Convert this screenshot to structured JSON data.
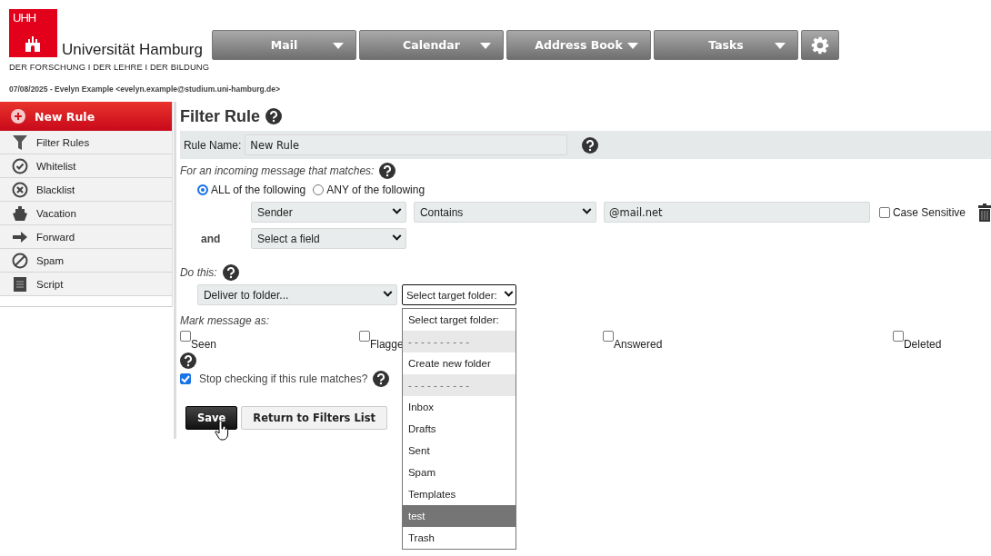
{
  "logo": {
    "mark": "UHH",
    "name": "Universität Hamburg",
    "tagline": "DER FORSCHUNG I DER LEHRE I DER BILDUNG"
  },
  "nav": [
    {
      "label": "Mail"
    },
    {
      "label": "Calendar"
    },
    {
      "label": "Address Book"
    },
    {
      "label": "Tasks"
    }
  ],
  "user_line": "07/08/2025 - Evelyn Example <evelyn.example@studium.uni-hamburg.de>",
  "sidebar": {
    "new_rule": "New Rule",
    "items": [
      {
        "label": "Filter Rules",
        "kind": "filter"
      },
      {
        "label": "Whitelist",
        "kind": "check"
      },
      {
        "label": "Blacklist",
        "kind": "cross"
      },
      {
        "label": "Vacation",
        "kind": "ship"
      },
      {
        "label": "Forward",
        "kind": "arrow"
      },
      {
        "label": "Spam",
        "kind": "ban"
      },
      {
        "label": "Script",
        "kind": "script"
      }
    ]
  },
  "form": {
    "title": "Filter Rule",
    "rule_name_label": "Rule Name:",
    "rule_name": "New Rule",
    "match_label": "For an incoming message that matches:",
    "match_modes": [
      {
        "label": "ALL of the following",
        "selected": true
      },
      {
        "label": "ANY of the following",
        "selected": false
      }
    ],
    "conditions": [
      {
        "field": "Sender",
        "operator": "Contains",
        "value": "@mail.net",
        "case_sensitive": {
          "label": "Case Sensitive",
          "checked": false
        }
      },
      {
        "prefix": "and",
        "field": "Select a field"
      }
    ],
    "action_label": "Do this:",
    "action": "Deliver to folder...",
    "target": "Select target folder:",
    "folder_options": [
      {
        "label": "Select target folder:",
        "kind": "option",
        "selected": false
      },
      {
        "label": "- - - - - - - - - -",
        "kind": "separator",
        "selected": false
      },
      {
        "label": "Create new folder",
        "kind": "option",
        "selected": false
      },
      {
        "label": "- - - - - - - - - -",
        "kind": "separator",
        "selected": false
      },
      {
        "label": "Inbox",
        "kind": "option",
        "selected": false
      },
      {
        "label": "Drafts",
        "kind": "option",
        "selected": false
      },
      {
        "label": "Sent",
        "kind": "option",
        "selected": false
      },
      {
        "label": "Spam",
        "kind": "option",
        "selected": false
      },
      {
        "label": "Templates",
        "kind": "option",
        "selected": false
      },
      {
        "label": "test",
        "kind": "option",
        "selected": true
      },
      {
        "label": "Trash",
        "kind": "option",
        "selected": false
      }
    ],
    "mark_label": "Mark message as:",
    "flags": [
      {
        "label": "Seen",
        "checked": false
      },
      {
        "label": "Flagge",
        "checked": false
      },
      {
        "label": "Answered",
        "checked": false
      },
      {
        "label": "Deleted",
        "checked": false
      }
    ],
    "stop": {
      "label": "Stop checking if this rule matches?",
      "checked": true
    },
    "buttons": [
      {
        "label": "Save",
        "kind": "primary"
      },
      {
        "label": "Return to Filters List",
        "kind": "secondary"
      }
    ]
  }
}
